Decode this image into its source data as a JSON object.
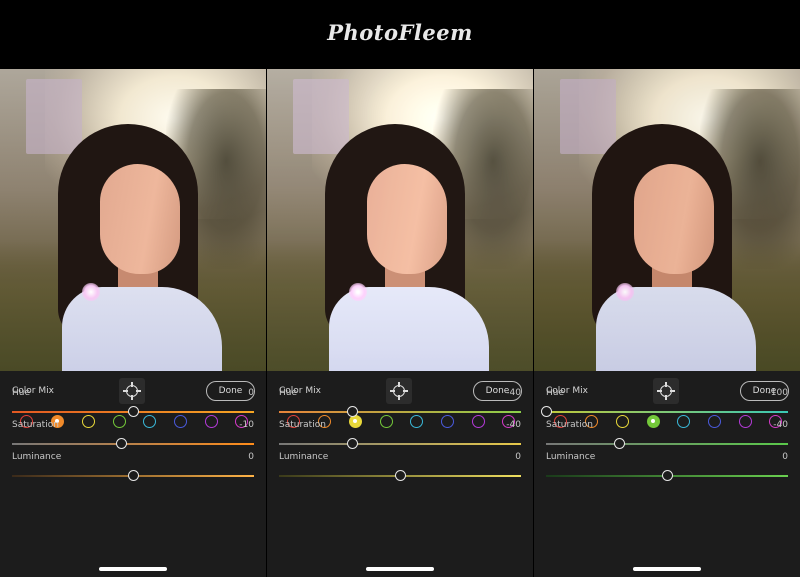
{
  "brand": "PhotoFleem",
  "panels": [
    {
      "title": "Color Mix",
      "done_label": "Done",
      "selected_swatch": 1,
      "rows": [
        {
          "label": "Hue",
          "value": "0",
          "level": 0,
          "track": [
            "#e25822",
            "#f5a623"
          ]
        },
        {
          "label": "Saturation",
          "value": "-10",
          "level": -10,
          "track": [
            "#777777",
            "#ff8c1a"
          ]
        },
        {
          "label": "Luminance",
          "value": "0",
          "level": 0,
          "track": [
            "#3a2a1a",
            "#ffb347"
          ]
        }
      ]
    },
    {
      "title": "Color Mix",
      "done_label": "Done",
      "selected_swatch": 2,
      "rows": [
        {
          "label": "Hue",
          "value": "-40",
          "level": -40,
          "track": [
            "#e8843a",
            "#8ccf4a"
          ]
        },
        {
          "label": "Saturation",
          "value": "-40",
          "level": -40,
          "track": [
            "#777777",
            "#e6c84a"
          ]
        },
        {
          "label": "Luminance",
          "value": "0",
          "level": 0,
          "track": [
            "#3a3a1a",
            "#f0e060"
          ]
        }
      ]
    },
    {
      "title": "Color Mix",
      "done_label": "Done",
      "selected_swatch": 3,
      "rows": [
        {
          "label": "Hue",
          "value": "-100",
          "level": -100,
          "track": [
            "#c0c83a",
            "#3ac8b4"
          ]
        },
        {
          "label": "Saturation",
          "value": "-40",
          "level": -40,
          "track": [
            "#777777",
            "#5ac84a"
          ]
        },
        {
          "label": "Luminance",
          "value": "0",
          "level": 0,
          "track": [
            "#1a3a1a",
            "#6ad050"
          ]
        }
      ]
    }
  ],
  "swatch_colors": [
    "#e0403a",
    "#f08a2a",
    "#e8d83a",
    "#74c83a",
    "#3ab8d8",
    "#4a5adc",
    "#b43ad8",
    "#d43ac8"
  ],
  "slider_range": [
    -100,
    100
  ]
}
